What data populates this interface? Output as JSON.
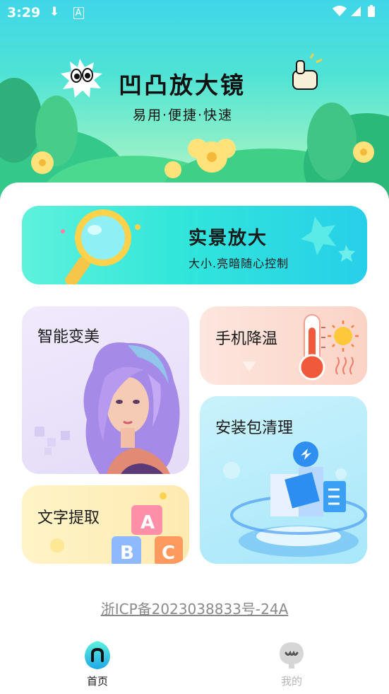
{
  "status_bar": {
    "time": "3:29",
    "left_icons": [
      "download-icon",
      "text-a-icon"
    ],
    "right_icons": [
      "wifi-icon",
      "signal-icon",
      "battery-icon"
    ]
  },
  "hero": {
    "title": "凹凸放大镜",
    "subtitle": "易用·便捷·快速"
  },
  "cards": {
    "magnify": {
      "title": "实景放大",
      "subtitle": "大小.亮暗随心控制",
      "icon": "magnifier-icon"
    },
    "beauty": {
      "title": "智能变美",
      "icon": "portrait-illustration"
    },
    "cooling": {
      "title": "手机降温",
      "icon": "thermometer-icon"
    },
    "cleanup": {
      "title": "安装包清理",
      "icon": "package-cleanup-icon"
    },
    "ocr": {
      "title": "文字提取",
      "icon": "abc-blocks-icon"
    }
  },
  "footer": {
    "icp": "浙ICP备2023038833号-24A"
  },
  "tabbar": {
    "items": [
      {
        "label": "首页",
        "icon": "home-icon",
        "active": true
      },
      {
        "label": "我的",
        "icon": "profile-icon",
        "active": false
      }
    ]
  },
  "colors": {
    "accent": "#2ad6e4",
    "inactive_tab": "#b5b5b5"
  }
}
